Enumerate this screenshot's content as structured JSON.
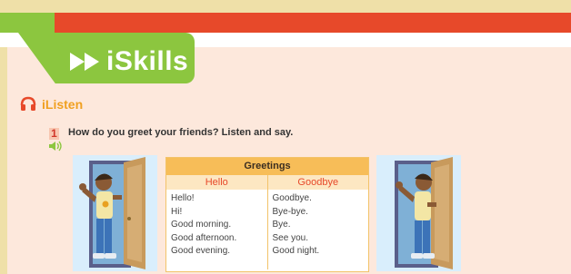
{
  "section": {
    "title": "iSkills"
  },
  "subsection": {
    "title": "iListen",
    "icon": "headphones-icon"
  },
  "activity": {
    "number": "1",
    "instruction": "How do you greet your friends? Listen and say.",
    "audio_icon": "audio-icon"
  },
  "table": {
    "title": "Greetings",
    "columns": [
      {
        "header": "Hello",
        "items": [
          "Hello!",
          "Hi!",
          "Good morning.",
          "Good afternoon.",
          "Good evening."
        ]
      },
      {
        "header": "Goodbye",
        "items": [
          "Goodbye.",
          "Bye-bye.",
          "Bye.",
          "See you.",
          "Good night."
        ]
      }
    ]
  },
  "illustrations": [
    {
      "name": "boy-entering-door"
    },
    {
      "name": "boy-leaving-door"
    }
  ],
  "colors": {
    "green": "#8cc63f",
    "orange": "#e7492a",
    "table_header": "#f7bd58",
    "page_background": "#fde8dc",
    "outer_background": "#efe0a8"
  }
}
